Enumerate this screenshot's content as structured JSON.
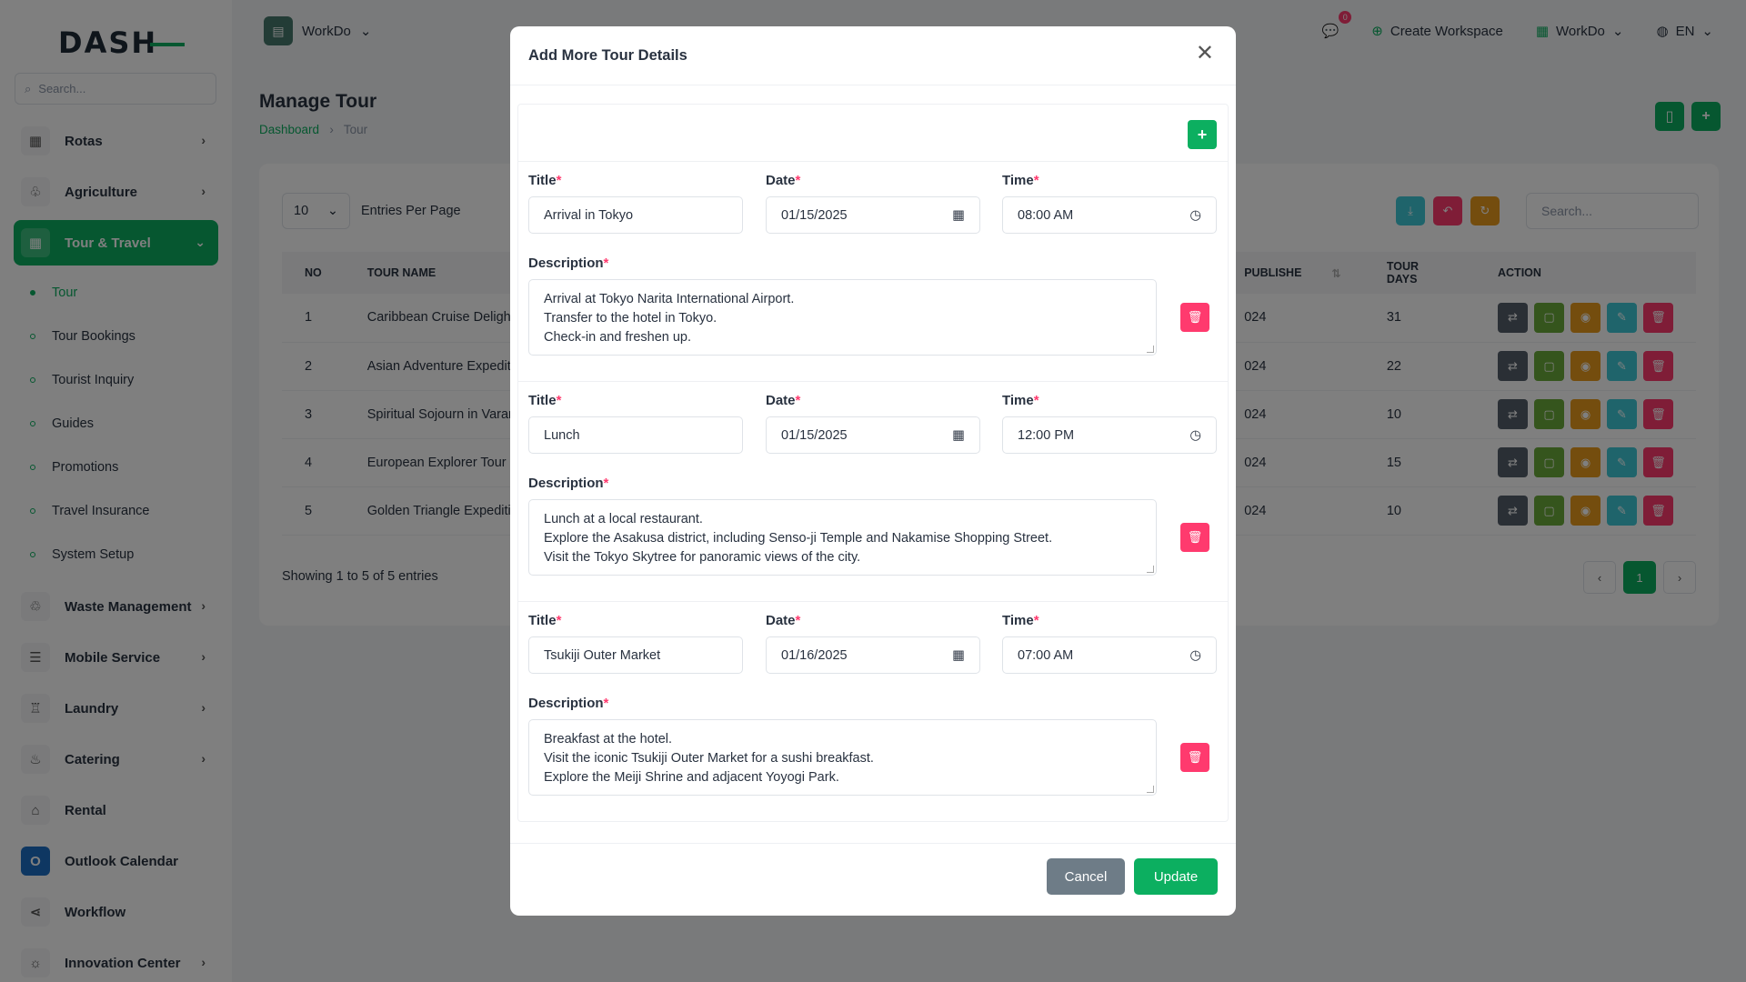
{
  "brand": {
    "logo_text": "DASH"
  },
  "sidebar": {
    "search_placeholder": "Search...",
    "items": [
      {
        "label": "Rotas",
        "icon": "▦"
      },
      {
        "label": "Agriculture",
        "icon": "♧"
      },
      {
        "label": "Tour & Travel",
        "icon": "▦"
      },
      {
        "label": "Waste Management",
        "icon": "♲"
      },
      {
        "label": "Mobile Service",
        "icon": "☰"
      },
      {
        "label": "Laundry",
        "icon": "♖"
      },
      {
        "label": "Catering",
        "icon": "♨"
      },
      {
        "label": "Rental",
        "icon": "⌂"
      },
      {
        "label": "Outlook Calendar",
        "icon": "O"
      },
      {
        "label": "Workflow",
        "icon": "⋖"
      },
      {
        "label": "Innovation Center",
        "icon": "☼"
      }
    ],
    "sub_items": [
      "Tour",
      "Tour Bookings",
      "Tourist Inquiry",
      "Guides",
      "Promotions",
      "Travel Insurance",
      "System Setup"
    ]
  },
  "topbar": {
    "workspace": "WorkDo",
    "notif_count": "0",
    "create_workspace": "Create Workspace",
    "workspace_menu": "WorkDo",
    "language": "EN"
  },
  "page": {
    "title": "Manage Tour",
    "breadcrumb_home": "Dashboard",
    "breadcrumb_current": "Tour"
  },
  "table": {
    "per_page": "10",
    "per_page_label": "Entries Per Page",
    "search_placeholder": "Search...",
    "headers": [
      "NO",
      "TOUR NAME",
      "PUBLISHE",
      "TOUR DAYS",
      "ACTION"
    ],
    "sort_icon": "⇅",
    "rows": [
      {
        "no": "1",
        "name": "Caribbean Cruise Delight",
        "published": "024",
        "days": "31"
      },
      {
        "no": "2",
        "name": "Asian Adventure Expedit",
        "published": "024",
        "days": "22"
      },
      {
        "no": "3",
        "name": "Spiritual Sojourn in Varar",
        "published": "024",
        "days": "10"
      },
      {
        "no": "4",
        "name": "European Explorer Tour",
        "published": "024",
        "days": "15"
      },
      {
        "no": "5",
        "name": "Golden Triangle Expeditic",
        "published": "024",
        "days": "10"
      }
    ],
    "showing": "Showing 1 to 5 of 5 entries",
    "page_current": "1",
    "page_prev": "‹",
    "page_next": "›"
  },
  "modal": {
    "title": "Add More Tour Details",
    "labels": {
      "title": "Title",
      "date": "Date",
      "time": "Time",
      "description": "Description",
      "required": "*"
    },
    "entries": [
      {
        "title": "Arrival in Tokyo",
        "date": "01/15/2025",
        "time": "08:00 AM",
        "description": [
          "Arrival at Tokyo Narita International Airport.",
          "Transfer to the hotel in Tokyo.",
          "Check-in and freshen up."
        ]
      },
      {
        "title": "Lunch",
        "date": "01/15/2025",
        "time": "12:00 PM",
        "description": [
          "Lunch at a local restaurant.",
          "Explore the Asakusa district, including Senso-ji Temple and Nakamise Shopping Street.",
          "Visit the Tokyo Skytree for panoramic views of the city."
        ]
      },
      {
        "title": "Tsukiji Outer Market",
        "date": "01/16/2025",
        "time": "07:00 AM",
        "description": [
          "Breakfast at the hotel.",
          "Visit the iconic Tsukiji Outer Market for a sushi breakfast.",
          "Explore the Meiji Shrine and adjacent Yoyogi Park."
        ]
      }
    ],
    "cancel": "Cancel",
    "update": "Update"
  },
  "colors": {
    "primary": "#0caf60",
    "danger": "#ff3a6e",
    "warning": "#e89a1c",
    "info": "#3ec9d6",
    "dark": "#555f6a",
    "secondary": "#6e7c87"
  }
}
